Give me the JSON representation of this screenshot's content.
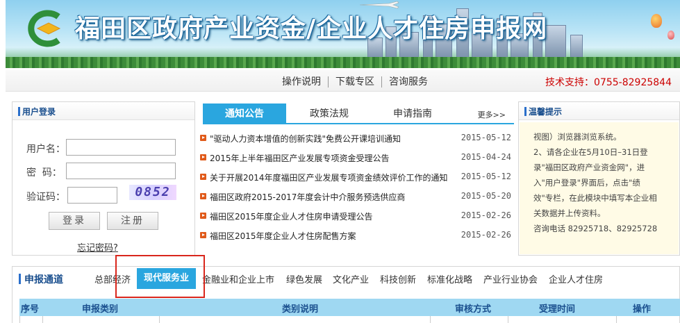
{
  "banner": {
    "title": "福田区政府产业资金/企业人才住房申报网"
  },
  "topnav": {
    "links": [
      "操作说明",
      "下载专区",
      "咨询服务"
    ],
    "support": "技术支持：0755-82925844"
  },
  "login": {
    "title": "用户登录",
    "username_label": "用户名：",
    "password_label": "密  码：",
    "captcha_label": "验证码：",
    "captcha_code": "0852",
    "login_button": "登录",
    "register_button": "注册",
    "forgot_link": "忘记密码?"
  },
  "news": {
    "tabs": [
      "通知公告",
      "政策法规",
      "申请指南"
    ],
    "active_tab": 0,
    "more": "更多>>",
    "items": [
      {
        "title": "\"驱动人力资本增值的创新实践\"免费公开课培训通知",
        "date": "2015-05-12"
      },
      {
        "title": "2015年上半年福田区产业发展专项资金受理公告",
        "date": "2015-04-24"
      },
      {
        "title": "关于开展2014年度福田区产业发展专项资金绩效评价工作的通知",
        "date": "2015-05-12"
      },
      {
        "title": "福田区政府2015-2017年度会计中介服务预选供应商",
        "date": "2015-05-20"
      },
      {
        "title": "福田区2015年度企业人才住房申请受理公告",
        "date": "2015-02-26"
      },
      {
        "title": "福田区2015年度企业人才住房配售方案",
        "date": "2015-02-26"
      }
    ]
  },
  "tips": {
    "title": "温馨提示",
    "lines": [
      "视图）浏览器浏览系统。",
      "2、请各企业在5月10日–31日登",
      "录\"福田区政府产业资金网\"，进",
      "入\"用户登录\"界面后，点击\"绩",
      "效\"专栏，在此模块中填写本企业相",
      "关数据并上传资料。",
      "咨询电话  82925718、82925728"
    ]
  },
  "channel": {
    "title": "申报通道",
    "tabs": [
      "总部经济",
      "现代服务业",
      "金融业和企业上市",
      "绿色发展",
      "文化产业",
      "科技创新",
      "标准化战略",
      "产业行业协会",
      "企业人才住房"
    ],
    "active_tab": 1,
    "columns": [
      "序号",
      "申报类别",
      "类别说明",
      "审核方式",
      "受理时间",
      "操作"
    ]
  }
}
